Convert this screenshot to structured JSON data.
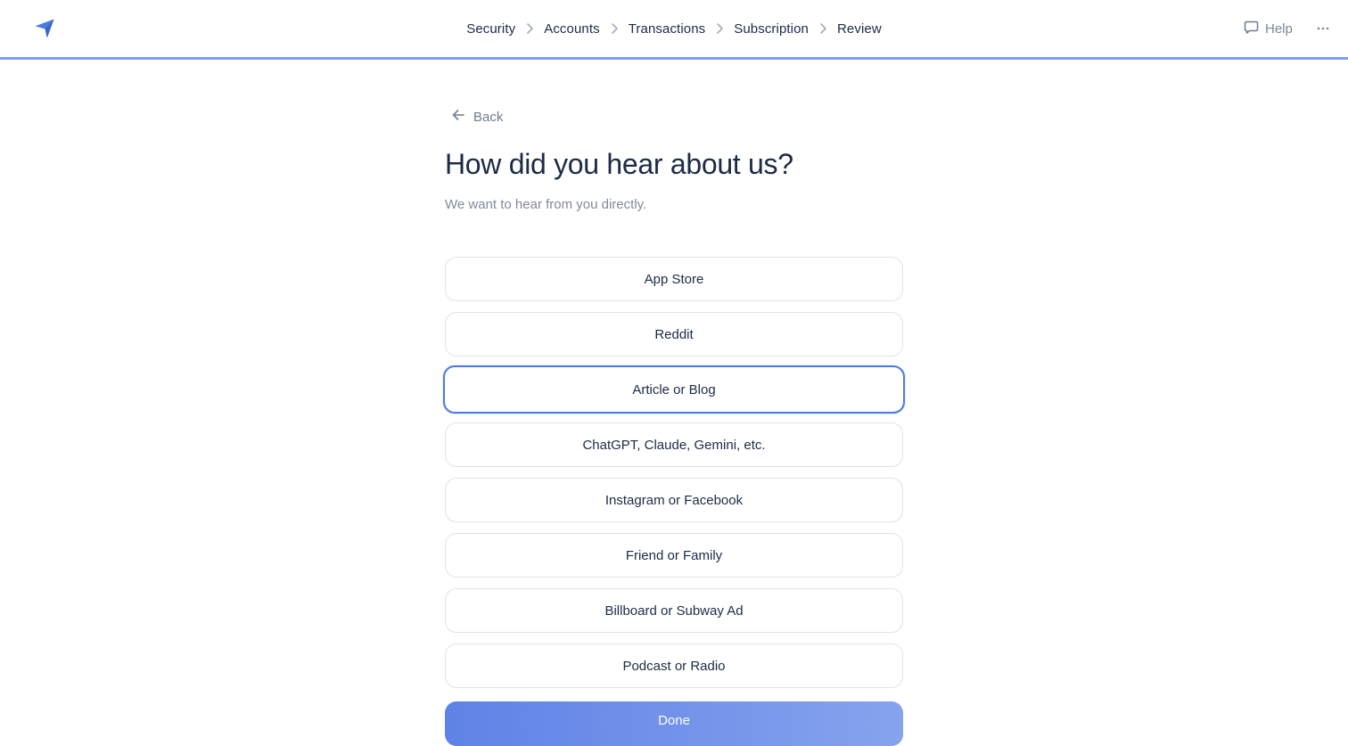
{
  "colors": {
    "accent": "#4d7ce0",
    "progress": "#7da2ea",
    "text": "#1c2b45",
    "muted": "#7f8a9c",
    "border": "#dfe3ea"
  },
  "header": {
    "logo_icon": "paper-plane-icon",
    "steps": [
      "Security",
      "Accounts",
      "Transactions",
      "Subscription",
      "Review"
    ],
    "help_label": "Help",
    "help_icon": "chat-bubble-icon",
    "more_icon": "more-horizontal-icon"
  },
  "main": {
    "back_label": "Back",
    "title": "How did you hear about us?",
    "subtitle": "We want to hear from you directly.",
    "options": [
      "App Store",
      "Reddit",
      "Article or Blog",
      "ChatGPT, Claude, Gemini, etc.",
      "Instagram or Facebook",
      "Friend or Family",
      "Billboard or Subway Ad",
      "Podcast or Radio"
    ],
    "selected_option": "Article or Blog",
    "done_label": "Done"
  }
}
